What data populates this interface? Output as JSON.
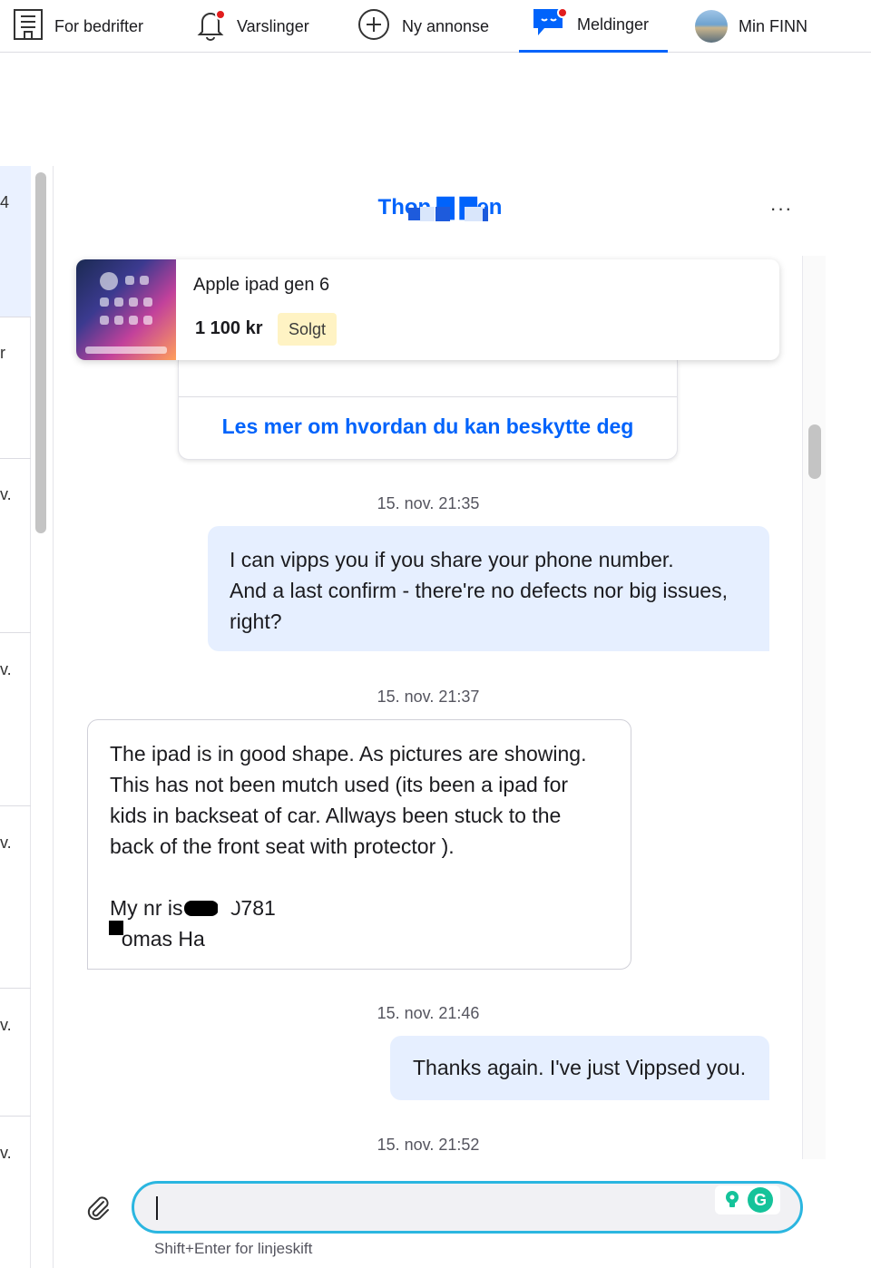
{
  "nav": {
    "business": "For bedrifter",
    "notifications": "Varslinger",
    "new_ad": "Ny annonse",
    "messages": "Meldinger",
    "my_finn": "Min FINN"
  },
  "conversation": {
    "name": "Thon ▇ ▇en",
    "more": "···"
  },
  "ad": {
    "title": "Apple ipad gen 6",
    "price": "1 100 kr",
    "status": "Solgt"
  },
  "info_link": "Les mer om hvordan du kan beskytte deg",
  "messages": [
    {
      "timestamp": "15. nov. 21:35",
      "direction": "out",
      "text": "I can vipps you if you share your phone number.\nAnd a last confirm - there're no defects nor big issues, right?"
    },
    {
      "timestamp": "15. nov. 21:37",
      "direction": "in",
      "text": "The ipad is in good shape. As pictures are showing. This has not been mutch used (its been a ipad for kids in backseat of car. Allways been stuck to the back of the front seat with protector ).\n\nMy nr is        0781\n  omas Ha      ."
    },
    {
      "timestamp": "15. nov. 21:46",
      "direction": "out",
      "text": "Thanks again. I've just Vippsed you."
    },
    {
      "timestamp": "15. nov. 21:52"
    }
  ],
  "composer": {
    "value": "",
    "hint": "Shift+Enter for linjeskift"
  },
  "colors": {
    "brand": "#0063fb",
    "outgoing_bubble": "#e6efff",
    "sold_badge": "#fff3c4",
    "focus_ring": "#2bb6e0"
  },
  "icons": [
    "building-icon",
    "bell-icon",
    "plus-circle-icon",
    "chat-icon",
    "paperclip-icon",
    "lightbulb-icon",
    "grammarly-icon"
  ]
}
